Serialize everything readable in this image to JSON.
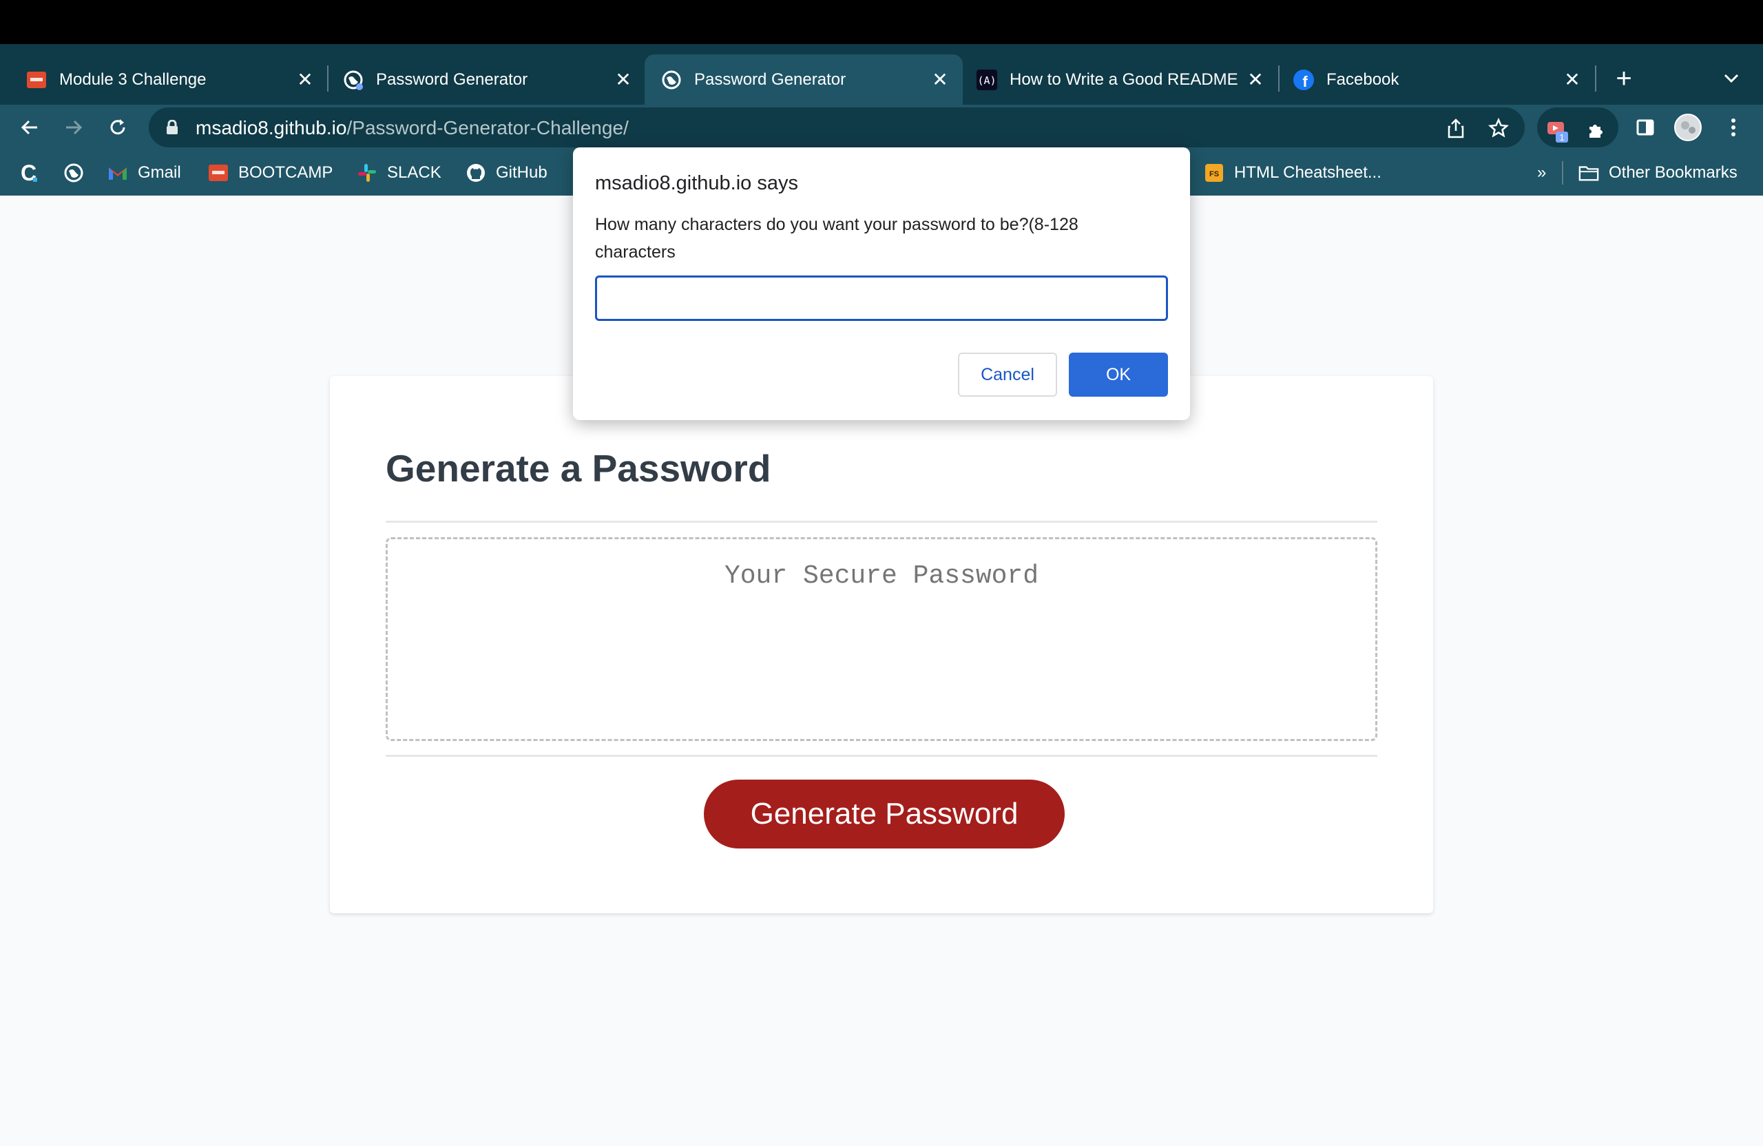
{
  "tabs": [
    {
      "title": "Module 3 Challenge",
      "icon": "bootcamp-icon"
    },
    {
      "title": "Password Generator",
      "icon": "globe-icon"
    },
    {
      "title": "Password Generator",
      "icon": "globe-icon",
      "active": true
    },
    {
      "title": "How to Write a Good README",
      "icon": "freecodecamp-icon"
    },
    {
      "title": "Facebook",
      "icon": "facebook-icon"
    }
  ],
  "address": {
    "host": "msadio8.github.io",
    "path": "/Password-Generator-Challenge/"
  },
  "bookmarks": {
    "gmail": "Gmail",
    "bootcamp": "BOOTCAMP",
    "slack": "SLACK",
    "github": "GitHub",
    "html_cheatsheet": "HTML Cheatsheet...",
    "overflow": "»",
    "other": "Other Bookmarks"
  },
  "extension_badge": "1",
  "page": {
    "heading": "Generate a Password",
    "password_placeholder": "Your Secure Password",
    "generate_button": "Generate Password"
  },
  "dialog": {
    "origin": "msadio8.github.io says",
    "message": "How many characters do you want your password to be?(8-128 characters",
    "input_value": "",
    "cancel_label": "Cancel",
    "ok_label": "OK"
  },
  "colors": {
    "tabbar": "#0f3a47",
    "toolbar": "#1f5566",
    "generate_button": "#a41e1b",
    "dialog_ok": "#2a6ad9",
    "heading": "#333d48"
  }
}
